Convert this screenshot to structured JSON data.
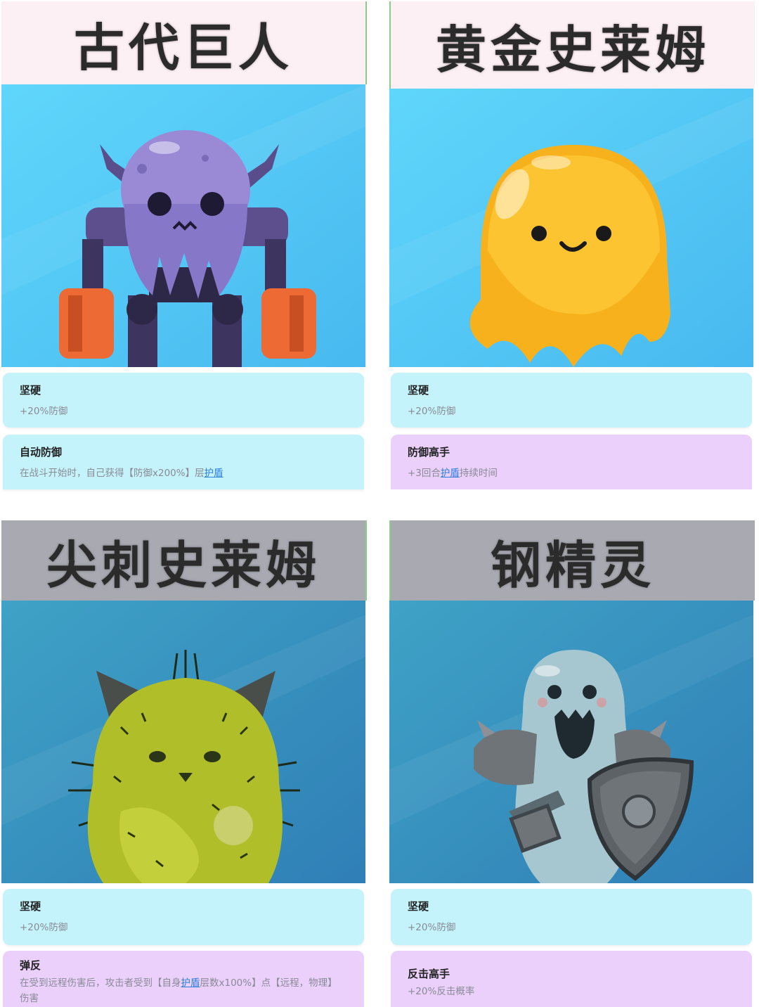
{
  "cards": [
    {
      "title": "古代巨人",
      "trait1": {
        "name": "坚硬",
        "desc": "+20%防御"
      },
      "trait2": {
        "name": "自动防御",
        "desc_pre": "在战斗开始时，自己获得【防御x200%】层",
        "desc_link": "护盾",
        "desc_post": ""
      }
    },
    {
      "title": "黄金史莱姆",
      "trait1": {
        "name": "坚硬",
        "desc": "+20%防御"
      },
      "trait2": {
        "name": "防御高手",
        "desc_pre": "+3回合",
        "desc_link": "护盾",
        "desc_post": "持续时间"
      }
    },
    {
      "title": "尖刺史莱姆",
      "trait1": {
        "name": "坚硬",
        "desc": "+20%防御"
      },
      "trait2": {
        "name": "弹反",
        "desc_pre": "在受到远程伤害后，攻击者受到【自身",
        "desc_link": "护盾",
        "desc_post": "层数x100%】点【远程，物理】伤害"
      }
    },
    {
      "title": "钢精灵",
      "trait1": {
        "name": "坚硬",
        "desc": "+20%防御"
      },
      "trait2": {
        "name": "反击高手",
        "desc_pre": "+20%反击概率",
        "desc_link": "",
        "desc_post": ""
      }
    }
  ],
  "colors": {
    "title_pink": "#fdf0f5",
    "title_gray": "#a9a9b1",
    "sky_blue": "#5ad0f7",
    "teal_blue": "#3b9cc2",
    "trait_cyan": "#c4f3fb",
    "trait_violet": "#ead0fb",
    "link_blue": "#2a7ee0"
  }
}
